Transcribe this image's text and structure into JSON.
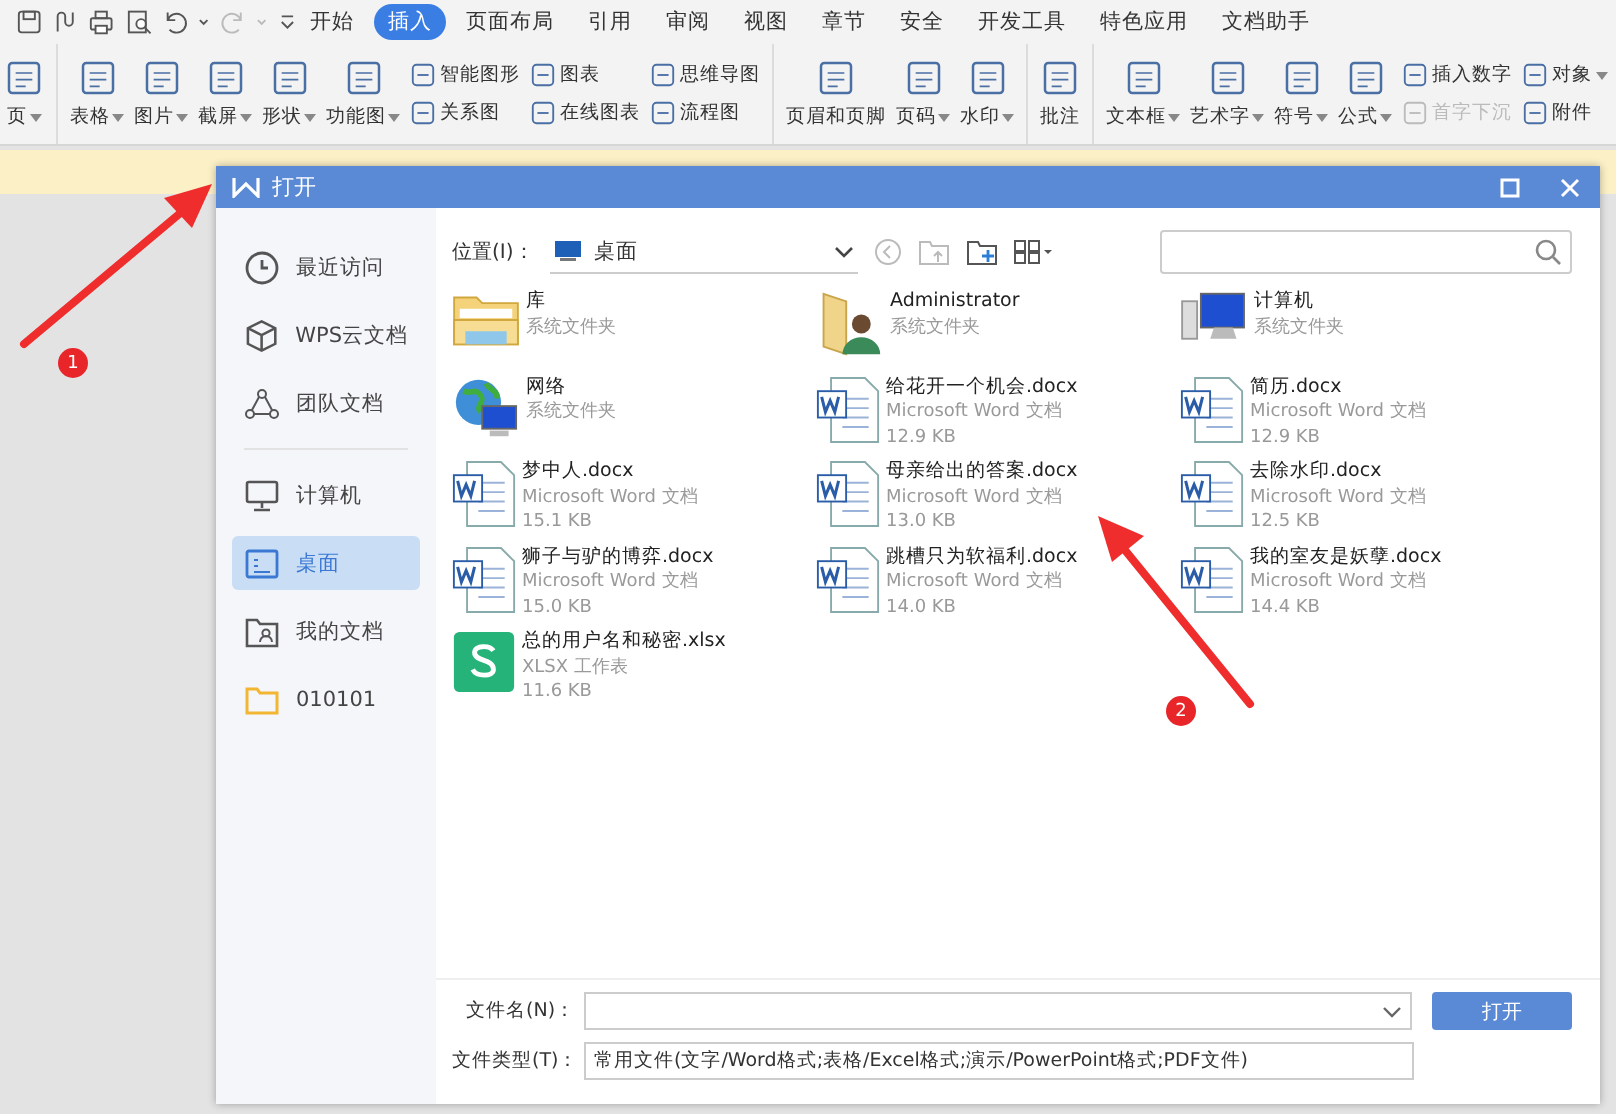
{
  "menu_tabs": [
    {
      "label": "开始",
      "selected": false
    },
    {
      "label": "插入",
      "selected": true
    },
    {
      "label": "页面布局",
      "selected": false
    },
    {
      "label": "引用",
      "selected": false
    },
    {
      "label": "审阅",
      "selected": false
    },
    {
      "label": "视图",
      "selected": false
    },
    {
      "label": "章节",
      "selected": false
    },
    {
      "label": "安全",
      "selected": false
    },
    {
      "label": "开发工具",
      "selected": false
    },
    {
      "label": "特色应用",
      "selected": false
    },
    {
      "label": "文档助手",
      "selected": false
    }
  ],
  "ribbon_groups": [
    [
      {
        "label": "页",
        "kind": "large",
        "dropdown": true,
        "disabled": false
      }
    ],
    [
      {
        "label": "表格",
        "kind": "large",
        "dropdown": true,
        "disabled": false
      },
      {
        "label": "图片",
        "kind": "large",
        "dropdown": true,
        "disabled": false
      },
      {
        "label": "截屏",
        "kind": "large",
        "dropdown": true,
        "disabled": false
      },
      {
        "label": "形状",
        "kind": "large",
        "dropdown": true,
        "disabled": false
      },
      {
        "label": "功能图",
        "kind": "large",
        "dropdown": true,
        "disabled": false
      },
      {
        "label": "智能图形",
        "kind": "small",
        "dropdown": false,
        "disabled": false
      },
      {
        "label": "关系图",
        "kind": "small",
        "dropdown": false,
        "disabled": false
      },
      {
        "label": "图表",
        "kind": "small",
        "dropdown": false,
        "disabled": false
      },
      {
        "label": "在线图表",
        "kind": "small",
        "dropdown": false,
        "disabled": false
      },
      {
        "label": "思维导图",
        "kind": "small",
        "dropdown": false,
        "disabled": false
      },
      {
        "label": "流程图",
        "kind": "small",
        "dropdown": false,
        "disabled": false
      }
    ],
    [
      {
        "label": "页眉和页脚",
        "kind": "large",
        "dropdown": false,
        "disabled": false
      },
      {
        "label": "页码",
        "kind": "large",
        "dropdown": true,
        "disabled": false
      },
      {
        "label": "水印",
        "kind": "large",
        "dropdown": true,
        "disabled": false
      }
    ],
    [
      {
        "label": "批注",
        "kind": "large",
        "dropdown": false,
        "disabled": false
      }
    ],
    [
      {
        "label": "文本框",
        "kind": "large",
        "dropdown": true,
        "disabled": false
      },
      {
        "label": "艺术字",
        "kind": "large",
        "dropdown": true,
        "disabled": false
      },
      {
        "label": "符号",
        "kind": "large",
        "dropdown": true,
        "disabled": false
      },
      {
        "label": "公式",
        "kind": "large",
        "dropdown": true,
        "disabled": false
      },
      {
        "label": "插入数字",
        "kind": "small",
        "dropdown": false,
        "disabled": false
      },
      {
        "label": "首字下沉",
        "kind": "small",
        "dropdown": false,
        "disabled": true
      },
      {
        "label": "对象",
        "kind": "small",
        "dropdown": true,
        "disabled": false
      },
      {
        "label": "附件",
        "kind": "small",
        "dropdown": false,
        "disabled": false
      }
    ]
  ],
  "dialog": {
    "title": "打开",
    "sidebar": [
      {
        "label": "最近访问",
        "selected": false
      },
      {
        "label": "WPS云文档",
        "selected": false
      },
      {
        "label": "团队文档",
        "selected": false
      },
      {
        "label": "计算机",
        "selected": false
      },
      {
        "label": "桌面",
        "selected": true
      },
      {
        "label": "我的文档",
        "selected": false
      },
      {
        "label": "010101",
        "selected": false
      }
    ],
    "location_label": "位置(I)：",
    "location": "桌面",
    "files": [
      {
        "name": "库",
        "type": "系统文件夹",
        "kind": "library"
      },
      {
        "name": "Administrator",
        "type": "系统文件夹",
        "kind": "user"
      },
      {
        "name": "计算机",
        "type": "系统文件夹",
        "kind": "computer"
      },
      {
        "name": "网络",
        "type": "系统文件夹",
        "kind": "network"
      },
      {
        "name": "给花开一个机会.docx",
        "type": "Microsoft Word 文档",
        "size": "12.9 KB",
        "kind": "word"
      },
      {
        "name": "简历.docx",
        "type": "Microsoft Word 文档",
        "size": "12.9 KB",
        "kind": "word"
      },
      {
        "name": "梦中人.docx",
        "type": "Microsoft Word 文档",
        "size": "15.1 KB",
        "kind": "word"
      },
      {
        "name": "母亲给出的答案.docx",
        "type": "Microsoft Word 文档",
        "size": "13.0 KB",
        "kind": "word"
      },
      {
        "name": "去除水印.docx",
        "type": "Microsoft Word 文档",
        "size": "12.5 KB",
        "kind": "word"
      },
      {
        "name": "狮子与驴的博弈.docx",
        "type": "Microsoft Word 文档",
        "size": "15.0 KB",
        "kind": "word"
      },
      {
        "name": "跳槽只为软福利.docx",
        "type": "Microsoft Word 文档",
        "size": "14.0 KB",
        "kind": "word"
      },
      {
        "name": "我的室友是妖孽.docx",
        "type": "Microsoft Word 文档",
        "size": "14.4 KB",
        "kind": "word"
      },
      {
        "name": "总的用户名和秘密.xlsx",
        "type": "XLSX 工作表",
        "size": "11.6 KB",
        "kind": "xlsx"
      }
    ],
    "filename_label": "文件名(N)：",
    "open_button": "打开",
    "filetype_label": "文件类型(T)：",
    "filetype": "常用文件(文字/Word格式;表格/Excel格式;演示/PowerPoint格式;PDF文件)"
  },
  "annotations": [
    {
      "label": "1"
    },
    {
      "label": "2"
    }
  ]
}
